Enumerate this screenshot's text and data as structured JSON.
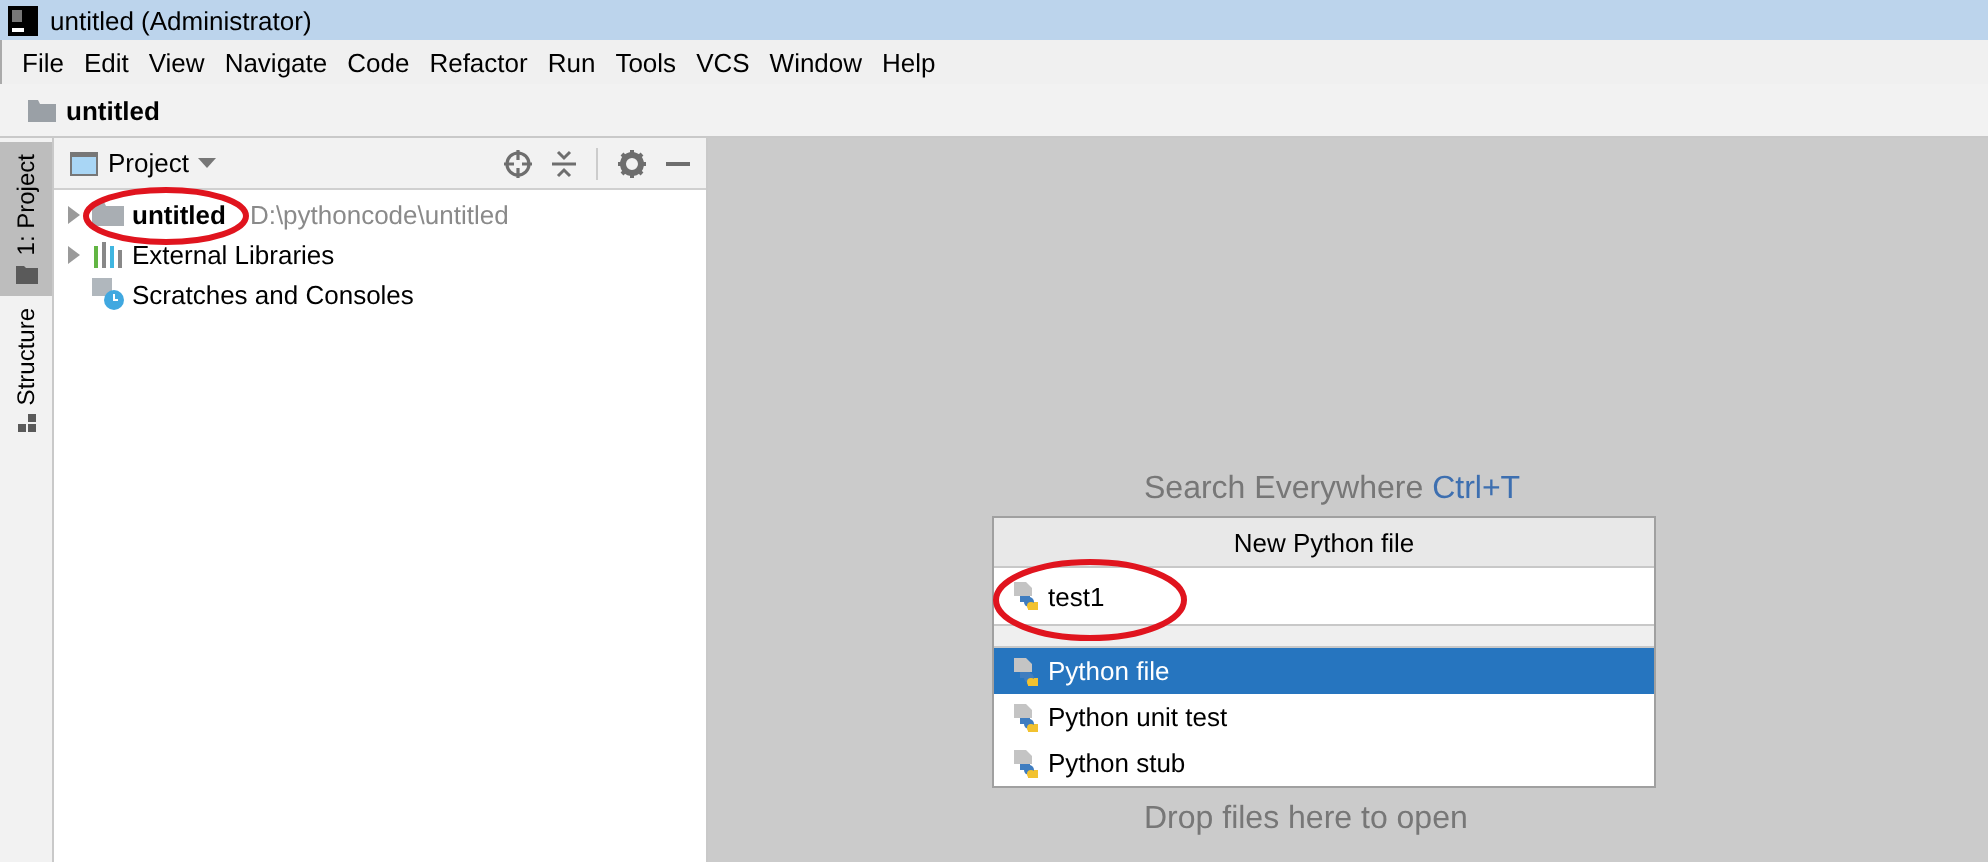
{
  "window": {
    "title": "untitled (Administrator)"
  },
  "menu": [
    "File",
    "Edit",
    "View",
    "Navigate",
    "Code",
    "Refactor",
    "Run",
    "Tools",
    "VCS",
    "Window",
    "Help"
  ],
  "breadcrumb": "untitled",
  "side_tabs": [
    {
      "label": "1: Project",
      "selected": true
    },
    {
      "label": "Structure",
      "selected": false
    }
  ],
  "project_panel": {
    "title": "Project",
    "tree": [
      {
        "label": "untitled",
        "path": "D:\\pythoncode\\untitled",
        "kind": "folder",
        "bold": true
      },
      {
        "label": "External Libraries",
        "kind": "libraries",
        "bold": false
      },
      {
        "label": "Scratches and Consoles",
        "kind": "scratches",
        "bold": false
      }
    ]
  },
  "editor": {
    "hint": "Search Everywhere",
    "shortcut": "Ctrl+T",
    "drop_hint": "Drop files here to open"
  },
  "popup": {
    "title": "New Python file",
    "value": "test1",
    "items": [
      {
        "label": "Python file",
        "selected": true
      },
      {
        "label": "Python unit test",
        "selected": false
      },
      {
        "label": "Python stub",
        "selected": false
      }
    ]
  }
}
